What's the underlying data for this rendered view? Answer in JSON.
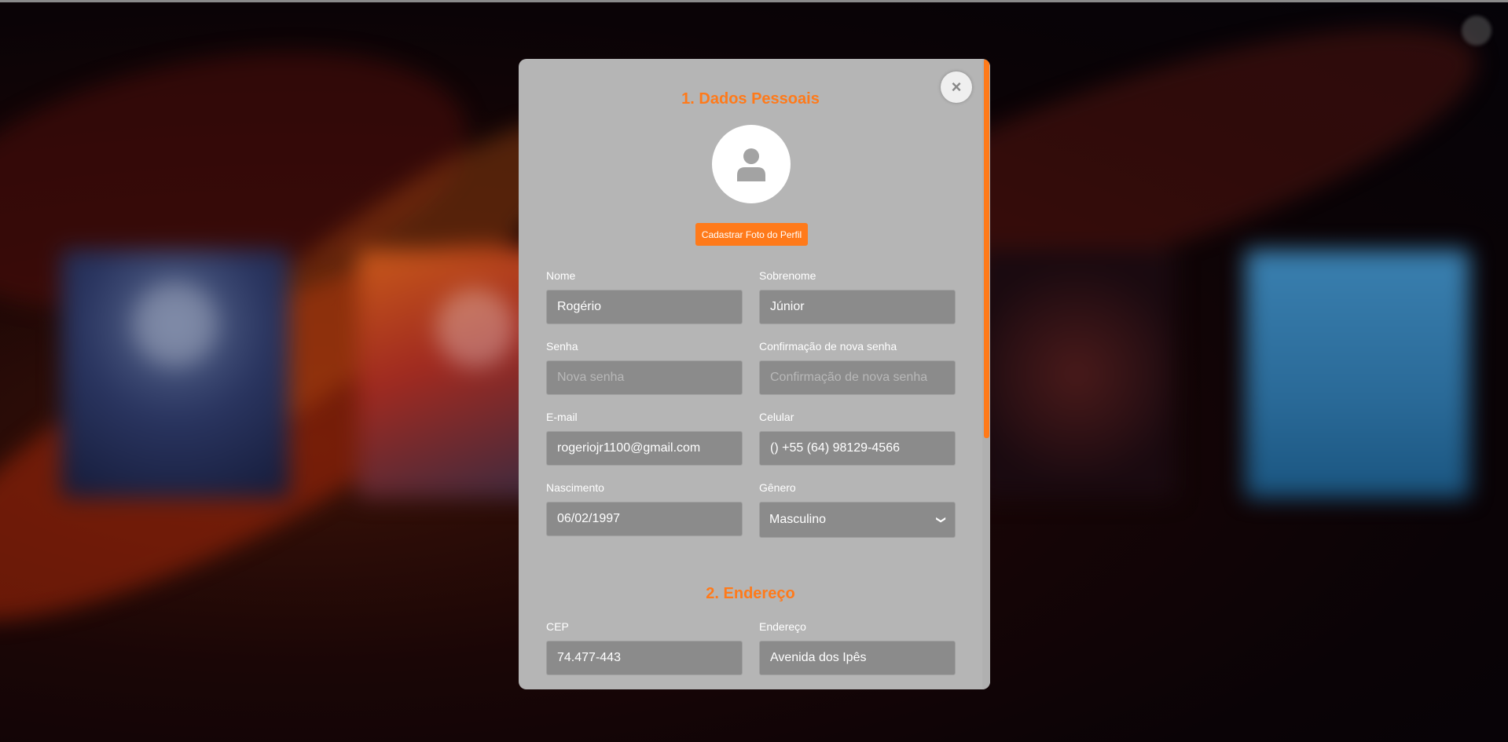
{
  "modal": {
    "close_symbol": "×",
    "sections": {
      "personal": "1. Dados Pessoais",
      "address": "2. Endereço"
    },
    "photo_button": "Cadastrar Foto do Perfil",
    "fields": {
      "nome": {
        "label": "Nome",
        "value": "Rogério"
      },
      "sobrenome": {
        "label": "Sobrenome",
        "value": "Júnior"
      },
      "senha": {
        "label": "Senha",
        "placeholder": "Nova senha"
      },
      "confirmacao": {
        "label": "Confirmação de nova senha",
        "placeholder": "Confirmação de nova senha"
      },
      "email": {
        "label": "E-mail",
        "value": "rogeriojr1100@gmail.com"
      },
      "celular": {
        "label": "Celular",
        "value": "() +55 (64) 98129-4566"
      },
      "nascimento": {
        "label": "Nascimento",
        "value": "06/02/1997"
      },
      "genero": {
        "label": "Gênero",
        "value": "Masculino"
      },
      "cep": {
        "label": "CEP",
        "value": "74.477-443"
      },
      "endereco": {
        "label": "Endereço",
        "value": "Avenida dos Ipês"
      }
    }
  },
  "icons": {
    "close": "close-icon",
    "avatar": "user-icon",
    "select": "chevron-down-icon"
  },
  "colors": {
    "accent": "#ff7a1a",
    "modal_bg": "#b5b5b5",
    "input_bg": "#8b8b8b"
  }
}
